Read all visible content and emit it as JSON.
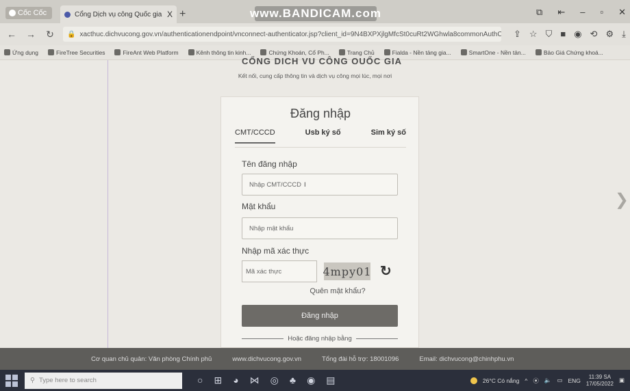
{
  "browser": {
    "name": "Cốc Cốc",
    "tab_title": "Cổng Dịch vụ công Quốc gia",
    "tab_close": "X",
    "new_tab": "+",
    "recorder_watermark": "www.BANDICAM.com",
    "url": "xacthuc.dichvucong.gov.vn/authenticationendpoint/vnconnect-authenticator.jsp?client_id=9N4BXPXjlgMfcSt0cuRt2WGhwla8commonAuthCal..."
  },
  "bookmarks": [
    "Ứng dụng",
    "FireTree Securities",
    "FireAnt Web Platform",
    "Kênh thông tin kinh...",
    "Chứng Khoán, Cổ Ph...",
    "Trang Chủ",
    "Fialda - Nền tảng gia...",
    "SmartOne - Nền tản...",
    "Bảo Giá Chứng khoá..."
  ],
  "site": {
    "header_title": "CỔNG DỊCH VỤ CÔNG QUỐC GIA",
    "tagline": "Kết nối, cung cấp thông tin và dịch vụ công mọi lúc, mọi nơi"
  },
  "login": {
    "title": "Đăng nhập",
    "tabs": [
      "CMT/CCCD",
      "Usb ký số",
      "Sim ký số"
    ],
    "username_label": "Tên đăng nhập",
    "username_placeholder": "Nhập CMT/CCCD",
    "password_label": "Mật khẩu",
    "password_placeholder": "Nhập mật khẩu",
    "captcha_label": "Nhập mã xác thực",
    "captcha_placeholder": "Mã xác thực",
    "captcha_text": "4mpy01",
    "forgot": "Quên mật khẩu?",
    "submit": "Đăng nhập",
    "alt": "Hoặc đăng nhập bằng"
  },
  "footer": {
    "agency": "Cơ quan chủ quản: Văn phòng Chính phủ",
    "site": "www.dichvucong.gov.vn",
    "hotline": "Tổng đài hỗ trợ: 18001096",
    "email": "Email: dichvucong@chinhphu.vn"
  },
  "taskbar": {
    "search_placeholder": "Type here to search",
    "weather": "26°C Có nắng",
    "lang": "ENG",
    "time": "11:39 SA",
    "date": "17/05/2022"
  }
}
